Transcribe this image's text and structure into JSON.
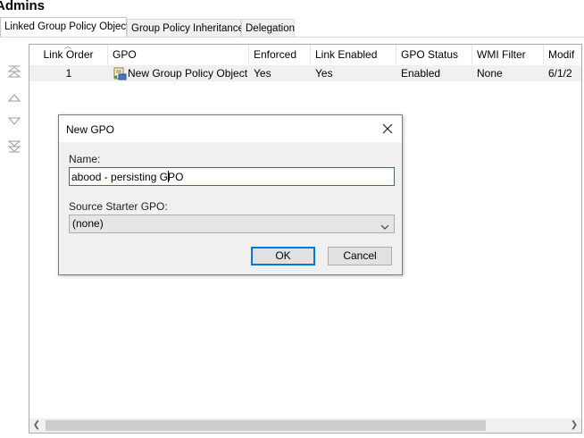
{
  "window": {
    "title": "Admins"
  },
  "tabs": [
    {
      "label": "Linked Group Policy Objects",
      "active": true
    },
    {
      "label": "Group Policy Inheritance",
      "active": false
    },
    {
      "label": "Delegation",
      "active": false
    }
  ],
  "order_controls": {
    "icons": [
      "move-to-top-icon",
      "move-up-icon",
      "move-down-icon",
      "move-to-bottom-icon"
    ]
  },
  "table": {
    "columns": [
      "Link Order",
      "GPO",
      "Enforced",
      "Link Enabled",
      "GPO Status",
      "WMI Filter",
      "Modif"
    ],
    "rows": [
      {
        "link_order": "1",
        "gpo": "New Group Policy Object",
        "enforced": "Yes",
        "link_enabled": "Yes",
        "gpo_status": "Enabled",
        "wmi_filter": "None",
        "modified": "6/1/2"
      }
    ]
  },
  "dialog": {
    "title": "New GPO",
    "name_label": "Name:",
    "name_value": "abood - persisting GPO",
    "source_label": "Source Starter GPO:",
    "source_value": "(none)",
    "ok_label": "OK",
    "cancel_label": "Cancel"
  },
  "colors": {
    "accent": "#0078d7",
    "dialog_bg": "#f0f0f0",
    "row_bg": "#f0f0f0"
  }
}
